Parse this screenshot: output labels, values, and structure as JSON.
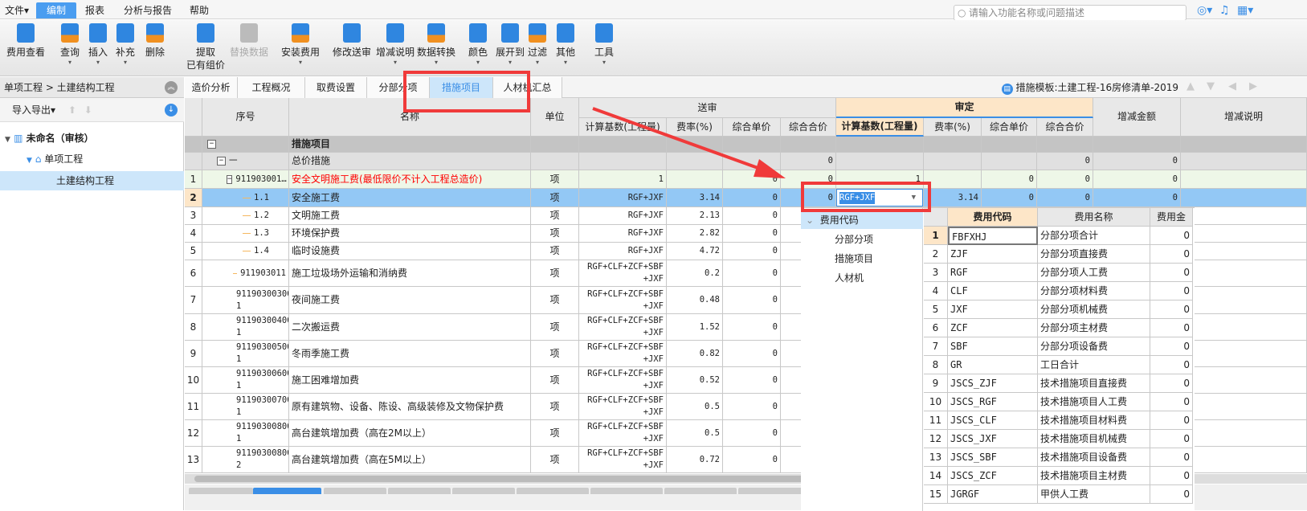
{
  "menu": [
    "文件",
    "编制",
    "报表",
    "分析与报告",
    "帮助"
  ],
  "search_placeholder": "请输入功能名称或问题描述",
  "toolbar": [
    {
      "label": "费用查看",
      "dd": false
    },
    {
      "label": "查询",
      "dd": true
    },
    {
      "label": "插入",
      "dd": true
    },
    {
      "label": "补充",
      "dd": true
    },
    {
      "label": "删除",
      "dd": false
    },
    {
      "label": "提取\n已有组价",
      "dd": false
    },
    {
      "label": "替换数据",
      "dd": false,
      "disabled": true
    },
    {
      "label": "安装费用",
      "dd": true
    },
    {
      "label": "修改送审",
      "dd": false
    },
    {
      "label": "增减说明",
      "dd": true
    },
    {
      "label": "数据转换",
      "dd": true
    },
    {
      "label": "颜色",
      "dd": true
    },
    {
      "label": "展开到",
      "dd": true
    },
    {
      "label": "过滤",
      "dd": true
    },
    {
      "label": "其他",
      "dd": true
    },
    {
      "label": "工具",
      "dd": true
    }
  ],
  "left": {
    "breadcrumb": "单项工程 > 土建结构工程",
    "import_export": "导入导出",
    "tree": [
      {
        "label": "未命名（审核）",
        "level": 0
      },
      {
        "label": "单项工程",
        "level": 1
      },
      {
        "label": "土建结构工程",
        "level": 2,
        "selected": true
      }
    ]
  },
  "tabs": [
    "造价分析",
    "工程概况",
    "取费设置",
    "分部分项",
    "措施项目",
    "人材机汇总"
  ],
  "active_tab": "措施项目",
  "template_label": "措施模板:土建工程-16房修清单-2019",
  "grid": {
    "headers": {
      "seq": "序号",
      "name": "名称",
      "unit": "单位",
      "songshen": "送审",
      "shending": "审定",
      "base": "计算基数(工程量)",
      "rate": "费率(%)",
      "price": "综合单价",
      "total": "综合合价",
      "diff": "增减金额",
      "note": "增减说明"
    },
    "rows": [
      {
        "num": "",
        "seq": "",
        "name": "措施项目",
        "type": "root"
      },
      {
        "num": "",
        "seq": "一",
        "name": "总价措施",
        "type": "group",
        "ss_total": "0",
        "sd_total": "0",
        "diff": "0"
      },
      {
        "num": "1",
        "seq": "911903001…",
        "name": "安全文明施工费(最低限价不计入工程总造价)",
        "unit": "项",
        "ss_base": "1",
        "ss_price": "0",
        "ss_total": "0",
        "sd_base": "1",
        "sd_price": "0",
        "sd_total": "0",
        "diff": "0",
        "type": "parent"
      },
      {
        "num": "2",
        "seq": "1.1",
        "name": "安全施工费",
        "unit": "项",
        "ss_base": "RGF+JXF",
        "ss_rate": "3.14",
        "ss_price": "0",
        "ss_total": "0",
        "sd_base": "RGF+JXF",
        "sd_rate": "3.14",
        "sd_price": "0",
        "sd_total": "0",
        "diff": "0",
        "type": "selected"
      },
      {
        "num": "3",
        "seq": "1.2",
        "name": "文明施工费",
        "unit": "项",
        "ss_base": "RGF+JXF",
        "ss_rate": "2.13",
        "ss_price": "0"
      },
      {
        "num": "4",
        "seq": "1.3",
        "name": "环境保护费",
        "unit": "项",
        "ss_base": "RGF+JXF",
        "ss_rate": "2.82",
        "ss_price": "0"
      },
      {
        "num": "5",
        "seq": "1.4",
        "name": "临时设施费",
        "unit": "项",
        "ss_base": "RGF+JXF",
        "ss_rate": "4.72",
        "ss_price": "0"
      },
      {
        "num": "6",
        "seq": "911903011",
        "name": "施工垃圾场外运输和消纳费",
        "unit": "项",
        "ss_base": "RGF+CLF+ZCF+SBF\n+JXF",
        "ss_rate": "0.2",
        "ss_price": "0"
      },
      {
        "num": "7",
        "seq": "91190300300\n1",
        "name": "夜间施工费",
        "unit": "项",
        "ss_base": "RGF+CLF+ZCF+SBF\n+JXF",
        "ss_rate": "0.48",
        "ss_price": "0"
      },
      {
        "num": "8",
        "seq": "91190300400\n1",
        "name": "二次搬运费",
        "unit": "项",
        "ss_base": "RGF+CLF+ZCF+SBF\n+JXF",
        "ss_rate": "1.52",
        "ss_price": "0"
      },
      {
        "num": "9",
        "seq": "91190300500\n1",
        "name": "冬雨季施工费",
        "unit": "项",
        "ss_base": "RGF+CLF+ZCF+SBF\n+JXF",
        "ss_rate": "0.82",
        "ss_price": "0"
      },
      {
        "num": "10",
        "seq": "91190300600\n1",
        "name": "施工困难增加费",
        "unit": "项",
        "ss_base": "RGF+CLF+ZCF+SBF\n+JXF",
        "ss_rate": "0.52",
        "ss_price": "0"
      },
      {
        "num": "11",
        "seq": "91190300700\n1",
        "name": "原有建筑物、设备、陈设、高级装修及文物保护费",
        "unit": "项",
        "ss_base": "RGF+CLF+ZCF+SBF\n+JXF",
        "ss_rate": "0.5",
        "ss_price": "0"
      },
      {
        "num": "12",
        "seq": "91190300800\n1",
        "name": "高台建筑增加费（高在2M以上）",
        "unit": "项",
        "ss_base": "RGF+CLF+ZCF+SBF\n+JXF",
        "ss_rate": "0.5",
        "ss_price": "0"
      },
      {
        "num": "13",
        "seq": "91190300800\n2",
        "name": "高台建筑增加费（高在5M以上）",
        "unit": "项",
        "ss_base": "RGF+CLF+ZCF+SBF\n+JXF",
        "ss_rate": "0.72",
        "ss_price": "0"
      }
    ]
  },
  "editor_value": "RGF+JXF",
  "popup": {
    "tree_root": "费用代码",
    "tree_items": [
      "分部分项",
      "措施项目",
      "人材机"
    ],
    "headers": [
      "费用代码",
      "费用名称",
      "费用金额"
    ],
    "rows": [
      [
        "FBFXHJ",
        "分部分项合计",
        "0"
      ],
      [
        "ZJF",
        "分部分项直接费",
        "0"
      ],
      [
        "RGF",
        "分部分项人工费",
        "0"
      ],
      [
        "CLF",
        "分部分项材料费",
        "0"
      ],
      [
        "JXF",
        "分部分项机械费",
        "0"
      ],
      [
        "ZCF",
        "分部分项主材费",
        "0"
      ],
      [
        "SBF",
        "分部分项设备费",
        "0"
      ],
      [
        "GR",
        "工日合计",
        "0"
      ],
      [
        "JSCS_ZJF",
        "技术措施项目直接费",
        "0"
      ],
      [
        "JSCS_RGF",
        "技术措施项目人工费",
        "0"
      ],
      [
        "JSCS_CLF",
        "技术措施项目材料费",
        "0"
      ],
      [
        "JSCS_JXF",
        "技术措施项目机械费",
        "0"
      ],
      [
        "JSCS_SBF",
        "技术措施项目设备费",
        "0"
      ],
      [
        "JSCS_ZCF",
        "技术措施项目主材费",
        "0"
      ],
      [
        "JGRGF",
        "甲供人工费",
        "0"
      ]
    ]
  },
  "colors": {
    "accent": "#3a8ee6",
    "selected_row": "#93c8f5",
    "header_shending": "#fde6c8",
    "annotation": "#f03a3a",
    "parent_row_text": "#ff0000",
    "parent_row_bg": "#eef7e8"
  }
}
